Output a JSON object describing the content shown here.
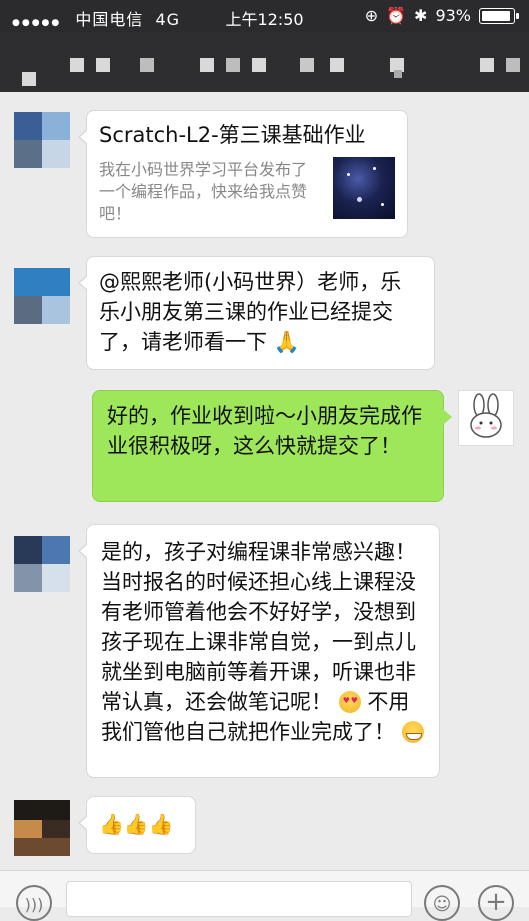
{
  "status_bar": {
    "carrier": "中国电信",
    "network": "4G",
    "time": "上午12:50",
    "battery": "93%",
    "battery_level": 0.93
  },
  "messages": [
    {
      "side": "left",
      "type": "link_card",
      "title": "Scratch-L2-第三课基础作业",
      "description": "我在小码世界学习平台发布了一个编程作品，快来给我点赞吧！"
    },
    {
      "side": "left",
      "type": "text",
      "text": "@熙熙老师(小码世界）老师，乐乐小朋友第三课的作业已经提交了，请老师看一下"
    },
    {
      "side": "right",
      "type": "text",
      "text": "好的，作业收到啦～小朋友完成作业很积极呀，这么快就提交了！"
    },
    {
      "side": "left",
      "type": "text",
      "text_part1": "是的，孩子对编程课非常感兴趣！当时报名的时候还担心线上课程没有老师管着他会不好好学，没想到孩子现在上课非常自觉，一到点儿就坐到电脑前等着开课，听课也非常认真，还会做笔记呢！",
      "text_part2": "不用我们管他自己就把作业完成了！"
    },
    {
      "side": "left",
      "type": "emoji",
      "emoji": "👍👍👍"
    }
  ],
  "colors": {
    "background": "#ebebeb",
    "own_bubble": "#9fe75a",
    "header": "#2e2e30"
  },
  "icons": {
    "voice": "voice-icon",
    "emoji": "emoji-icon",
    "add": "plus-icon"
  }
}
